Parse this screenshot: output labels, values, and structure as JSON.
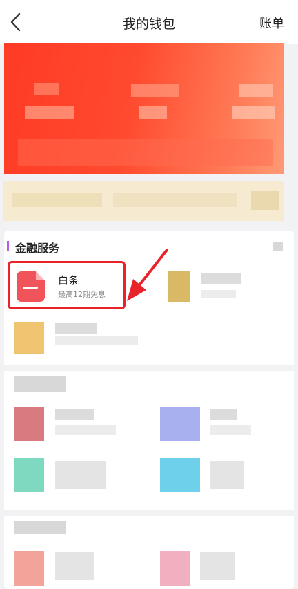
{
  "header": {
    "title": "我的钱包",
    "bill_label": "账单"
  },
  "finance_section": {
    "title": "金融服务",
    "featured": {
      "name": "白条",
      "subtitle": "最高12期免息"
    }
  },
  "colors": {
    "accent_red": "#e8232a",
    "icon_red": "#f1535b",
    "card_red": "#ff3b26",
    "section_marker": "#b35cf0"
  },
  "icons": [
    "back-icon",
    "baitiao-icon",
    "arrow-annotation"
  ]
}
